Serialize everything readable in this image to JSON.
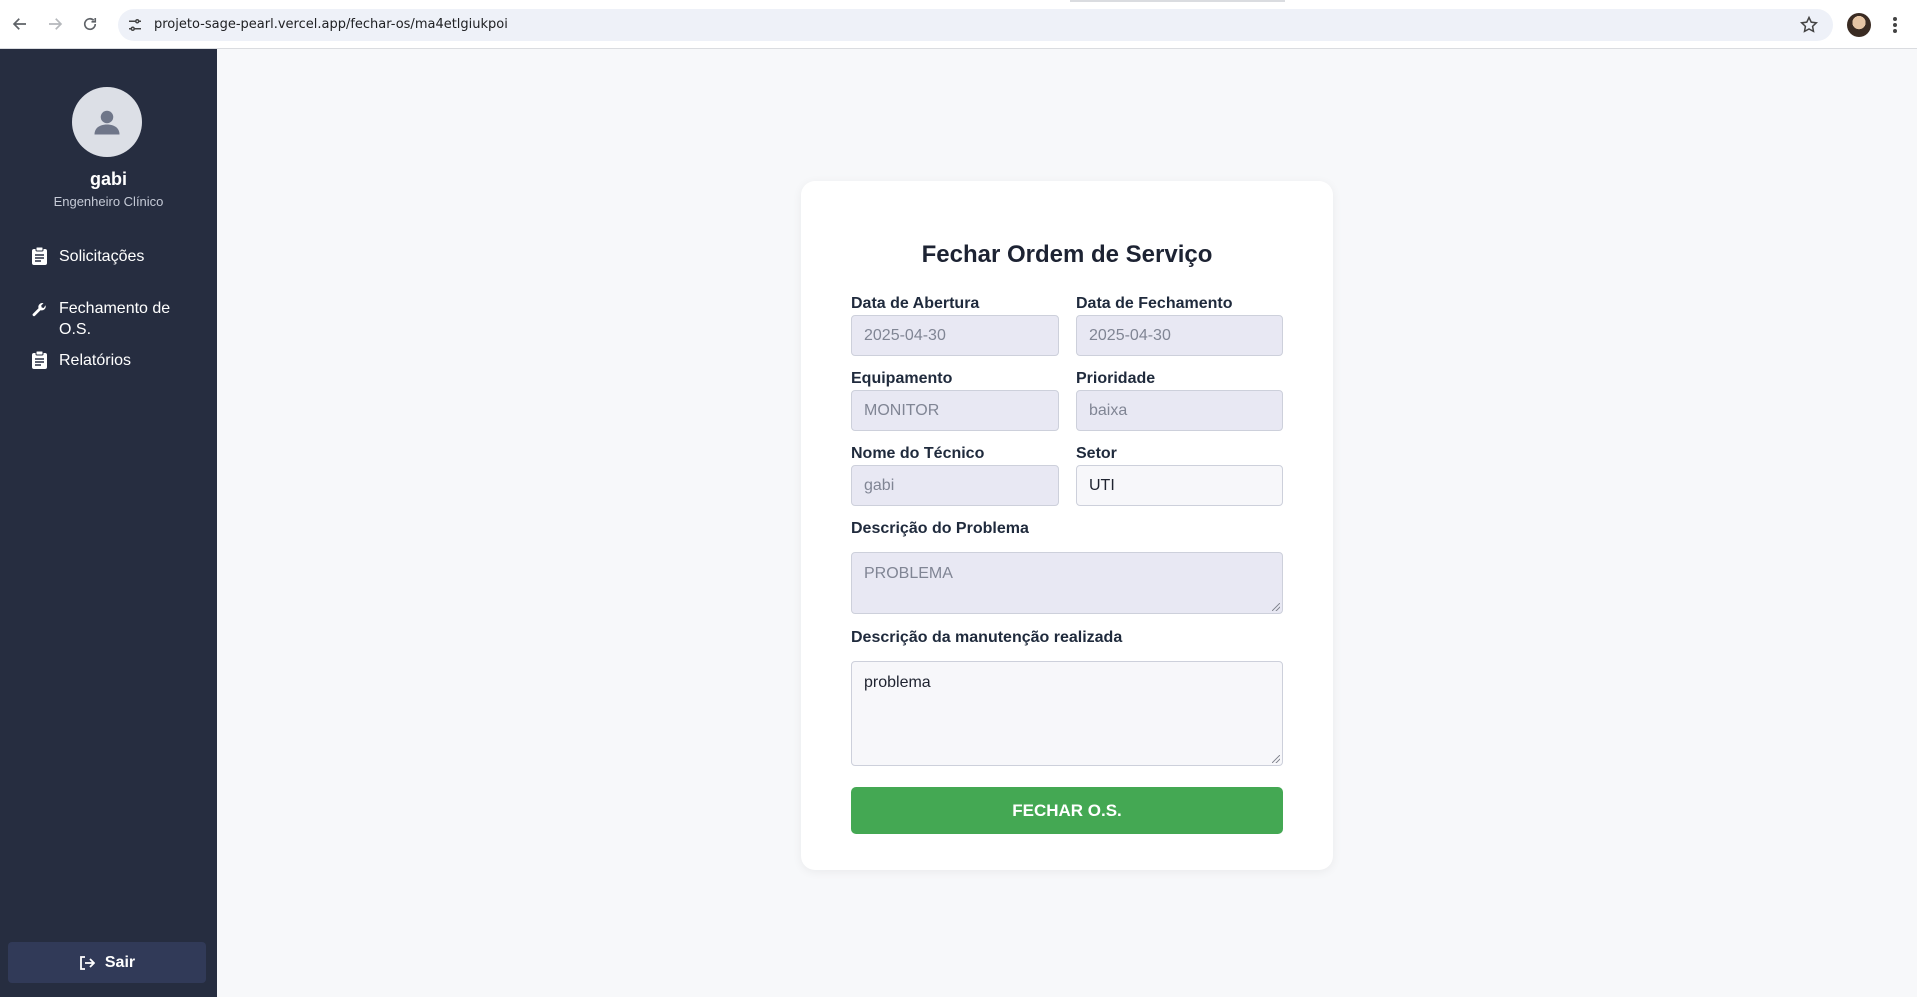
{
  "browser": {
    "url": "projeto-sage-pearl.vercel.app/fechar-os/ma4etlgiukpoi"
  },
  "sidebar": {
    "user_name": "gabi",
    "user_role": "Engenheiro Clínico",
    "items": [
      {
        "label": "Solicitações",
        "icon": "clipboard-icon"
      },
      {
        "label": "Fechamento de O.S.",
        "icon": "wrench-icon"
      },
      {
        "label": "Relatórios",
        "icon": "clipboard-icon"
      }
    ],
    "logout_label": "Sair"
  },
  "form": {
    "title": "Fechar Ordem de Serviço",
    "data_abertura": {
      "label": "Data de Abertura",
      "value": "2025-04-30"
    },
    "data_fechamento": {
      "label": "Data de Fechamento",
      "value": "2025-04-30"
    },
    "equipamento": {
      "label": "Equipamento",
      "value": "MONITOR"
    },
    "prioridade": {
      "label": "Prioridade",
      "value": "baixa"
    },
    "tecnico": {
      "label": "Nome do Técnico",
      "value": "gabi"
    },
    "setor": {
      "label": "Setor",
      "value": "UTI"
    },
    "problema": {
      "label": "Descrição do Problema",
      "value": "PROBLEMA"
    },
    "manutencao": {
      "label": "Descrição da manutenção realizada",
      "value": "problema"
    },
    "submit_label": "FECHAR O.S."
  },
  "colors": {
    "sidebar_bg": "#262d40",
    "submit_green": "#44a853",
    "page_bg": "#f7f8fa"
  }
}
